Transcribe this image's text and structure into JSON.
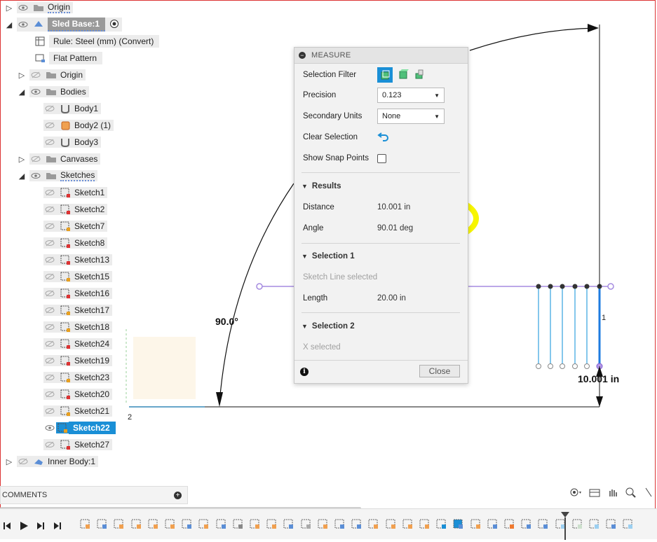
{
  "browser": {
    "origin_top": "Origin",
    "component": "Sled Base:1",
    "rule": "Rule: Steel (mm) (Convert)",
    "flat_pattern": "Flat Pattern",
    "origin": "Origin",
    "bodies": "Bodies",
    "body_items": [
      "Body1",
      "Body2 (1)",
      "Body3"
    ],
    "canvases": "Canvases",
    "sketches": "Sketches",
    "sketch_items": [
      "Sketch1",
      "Sketch2",
      "Sketch7",
      "Sketch8",
      "Sketch13",
      "Sketch15",
      "Sketch16",
      "Sketch17",
      "Sketch18",
      "Sketch24",
      "Sketch19",
      "Sketch23",
      "Sketch20",
      "Sketch21",
      "Sketch22",
      "Sketch27"
    ],
    "selected_sketch": "Sketch22",
    "inner_body": "Inner Body:1"
  },
  "measure": {
    "title": "MEASURE",
    "selection_filter_label": "Selection Filter",
    "precision_label": "Precision",
    "precision_value": "0.123",
    "secondary_units_label": "Secondary Units",
    "secondary_units_value": "None",
    "clear_selection_label": "Clear Selection",
    "show_snap_points_label": "Show Snap Points",
    "results_header": "Results",
    "distance_label": "Distance",
    "distance_value": "10.001 in",
    "angle_label": "Angle",
    "angle_value": "90.01 deg",
    "selection1_header": "Selection 1",
    "selection1_status": "Sketch Line selected",
    "length_label": "Length",
    "length_value": "20.00 in",
    "selection2_header": "Selection 2",
    "selection2_status": "X selected",
    "close_label": "Close"
  },
  "canvas": {
    "angle_annotation": "90.0°",
    "distance_annotation": "10.001 in",
    "point_label_1": "1",
    "point_label_2": "2",
    "highlight_color": "#f7f500",
    "sketch_line_color": "#a58be0",
    "selected_line_color": "#1e7be0",
    "construction_color": "#5ab4e6"
  },
  "comments": {
    "label": "COMMENTS"
  }
}
